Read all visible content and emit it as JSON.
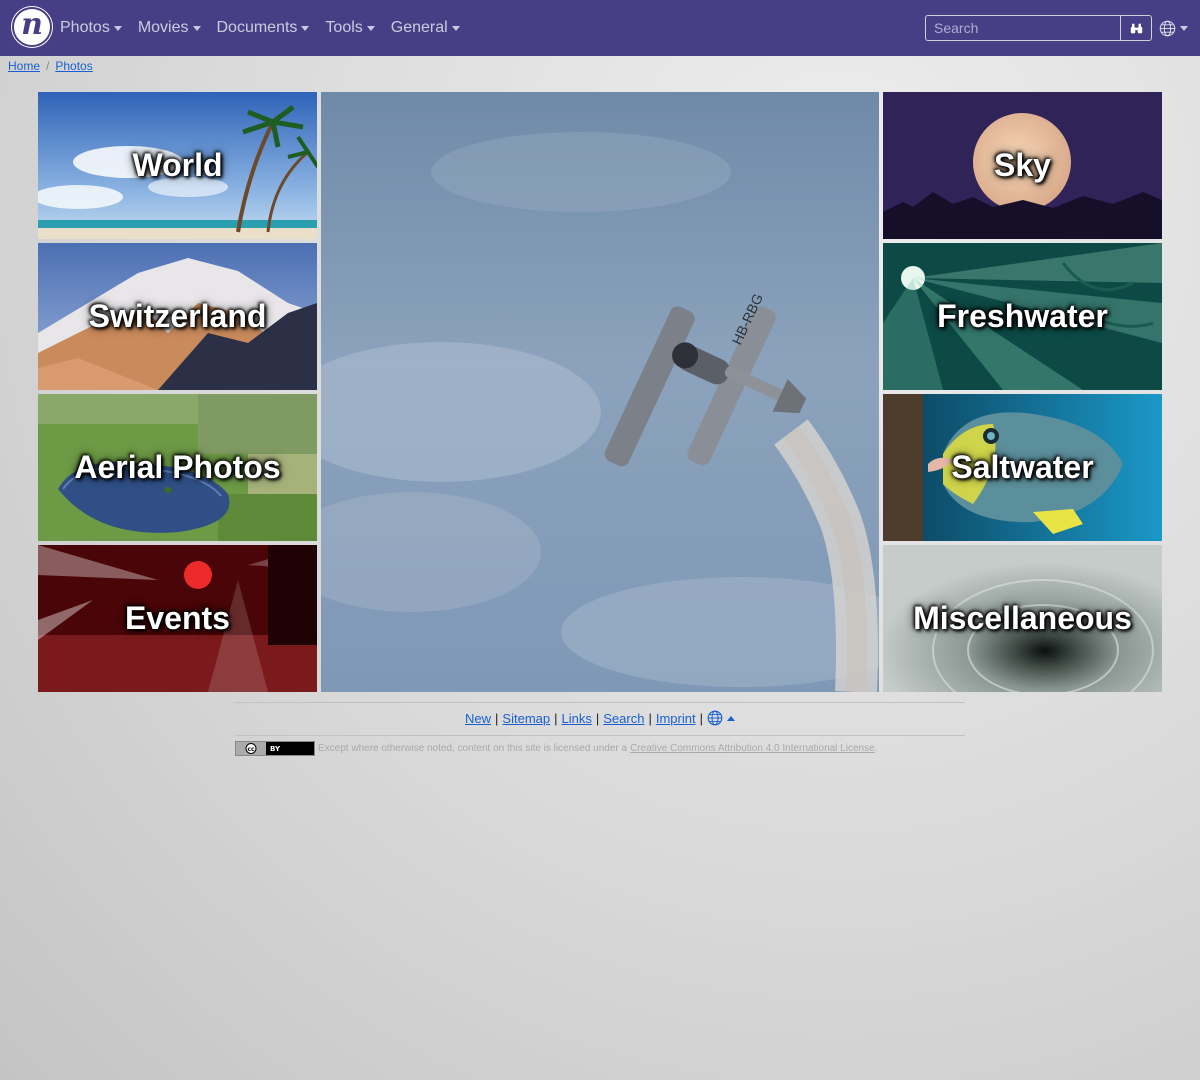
{
  "navbar": {
    "logo_letter": "n",
    "menu": [
      {
        "label": "Photos"
      },
      {
        "label": "Movies"
      },
      {
        "label": "Documents"
      },
      {
        "label": "Tools"
      },
      {
        "label": "General"
      }
    ],
    "search_placeholder": "Search",
    "search_icon": "binoculars-icon",
    "language_icon": "globe-icon"
  },
  "breadcrumb": [
    {
      "label": "Home"
    },
    {
      "label": "Photos"
    }
  ],
  "tiles": {
    "left": [
      {
        "label": "World"
      },
      {
        "label": "Switzerland"
      },
      {
        "label": "Aerial Photos"
      },
      {
        "label": "Events"
      }
    ],
    "right": [
      {
        "label": "Sky"
      },
      {
        "label": "Freshwater"
      },
      {
        "label": "Saltwater"
      },
      {
        "label": "Miscellaneous"
      }
    ]
  },
  "center_photo": {
    "plane_registration": "HB-RBG"
  },
  "footer": {
    "links": [
      "New",
      "Sitemap",
      "Links",
      "Search",
      "Imprint"
    ],
    "separator": "|",
    "license_prefix": "Except where otherwise noted, content on this site is licensed under a",
    "license_link": "Creative Commons Attribution 4.0 International License",
    "license_suffix": ".",
    "cc_badge_text": "BY"
  },
  "colors": {
    "navbar": "#473f86",
    "link": "#1a5fd1"
  }
}
